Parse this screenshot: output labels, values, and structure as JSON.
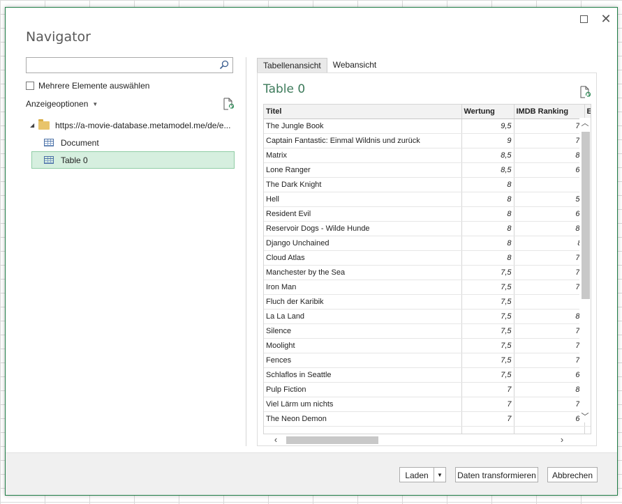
{
  "dialog": {
    "title": "Navigator"
  },
  "left": {
    "search_placeholder": "",
    "multi_select_label": "Mehrere Elemente auswählen",
    "display_options_label": "Anzeigeoptionen",
    "tree": {
      "root_label": "https://a-movie-database.metamodel.me/de/e...",
      "items": [
        {
          "label": "Document",
          "selected": false
        },
        {
          "label": "Table 0",
          "selected": true
        }
      ]
    }
  },
  "right": {
    "tabs": [
      "Tabellenansicht",
      "Webansicht"
    ],
    "active_tab": "Tabellenansicht",
    "preview_title": "Table 0",
    "columns": [
      "Titel",
      "Wertung",
      "IMDB Ranking",
      "Er"
    ],
    "rows": [
      [
        "The Jungle Book",
        "9,5",
        "7,"
      ],
      [
        "Captain Fantastic: Einmal Wildnis und zurück",
        "9",
        "7,"
      ],
      [
        "Matrix",
        "8,5",
        "8,"
      ],
      [
        "Lone Ranger",
        "8,5",
        "6,"
      ],
      [
        "The Dark Knight",
        "8",
        ""
      ],
      [
        "Hell",
        "8",
        "5,"
      ],
      [
        "Resident Evil",
        "8",
        "6,"
      ],
      [
        "Reservoir Dogs - Wilde Hunde",
        "8",
        "8,"
      ],
      [
        "Django Unchained",
        "8",
        "8"
      ],
      [
        "Cloud Atlas",
        "8",
        "7,"
      ],
      [
        "Manchester by the Sea",
        "7,5",
        "7,"
      ],
      [
        "Iron Man",
        "7,5",
        "7,"
      ],
      [
        "Fluch der Karibik",
        "7,5",
        ""
      ],
      [
        "La La Land",
        "7,5",
        "8,"
      ],
      [
        "Silence",
        "7,5",
        "7,"
      ],
      [
        "Moolight",
        "7,5",
        "7,"
      ],
      [
        "Fences",
        "7,5",
        "7,"
      ],
      [
        "Schlaflos in Seattle",
        "7,5",
        "6,"
      ],
      [
        "Pulp Fiction",
        "7",
        "8,"
      ],
      [
        "Viel Lärm um nichts",
        "7",
        "7,"
      ],
      [
        "The Neon Demon",
        "7",
        "6,"
      ],
      [
        "",
        "",
        ""
      ]
    ]
  },
  "footer": {
    "load_label": "Laden",
    "transform_label": "Daten transformieren",
    "cancel_label": "Abbrechen"
  },
  "colors": {
    "accent": "#1f7d46",
    "selected_bg": "#d6efdf"
  }
}
